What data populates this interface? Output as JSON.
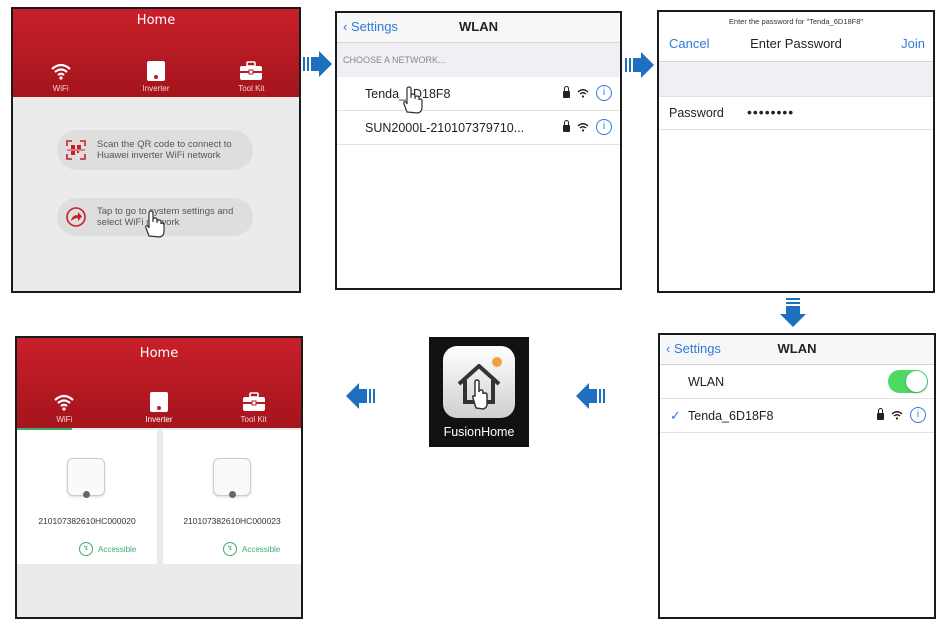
{
  "panel_app1": {
    "title": "Home",
    "tabs": [
      "WiFi",
      "Inverter",
      "Tool Kit"
    ],
    "scan_text": "Scan the QR code to connect to Huawei inverter WiFi network",
    "tap_text": "Tap to go to system settings and select WiFi network"
  },
  "panel_wlan_list": {
    "back": "Settings",
    "title": "WLAN",
    "section": "CHOOSE A NETWORK...",
    "networks": [
      "Tenda_6D18F8",
      "SUN2000L-210107379710..."
    ]
  },
  "panel_password": {
    "prompt": "Enter the password for \"Tenda_6D18F8\"",
    "cancel": "Cancel",
    "title": "Enter Password",
    "join": "Join",
    "field_label": "Password",
    "field_value": "••••••••"
  },
  "panel_wlan_connected": {
    "back": "Settings",
    "title": "WLAN",
    "wlan_label": "WLAN",
    "check": "✓",
    "network": "Tenda_6D18F8"
  },
  "fusionhome": {
    "label": "FusionHome"
  },
  "panel_app2": {
    "title": "Home",
    "tabs": [
      "WiFi",
      "Inverter",
      "Tool Kit"
    ],
    "devices": [
      {
        "sn": "210107382610HC000020",
        "status": "Accessible"
      },
      {
        "sn": "210107382610HC000023",
        "status": "Accessible"
      }
    ]
  },
  "colors": {
    "app_red": "#b81c24",
    "ios_blue": "#2f7bd8",
    "arrow_blue": "#1f6fbf",
    "toggle_green": "#4cd964"
  },
  "icons": [
    "wifi-icon",
    "inverter-icon",
    "toolkit-icon",
    "qr-scan-icon",
    "share-arrow-icon",
    "hand-pointer-icon",
    "lock-icon",
    "info-icon",
    "house-icon"
  ]
}
